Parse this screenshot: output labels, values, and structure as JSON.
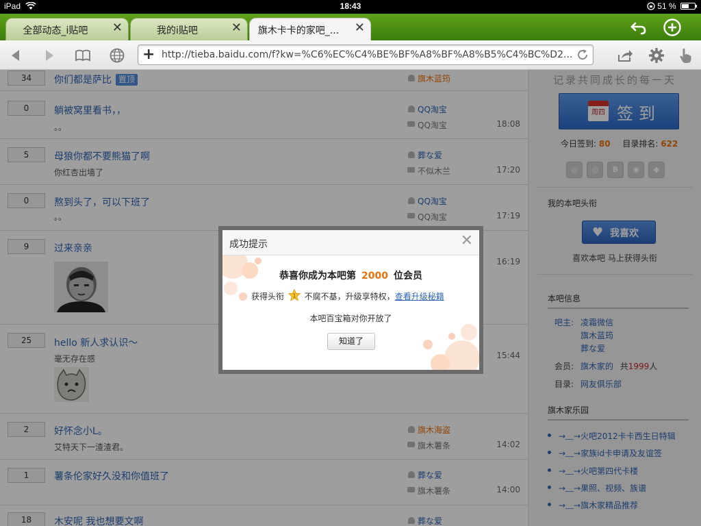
{
  "status_bar": {
    "device": "iPad",
    "time": "18:43",
    "battery": "51 %",
    "battery_level": 0.51
  },
  "tabs": [
    {
      "label": "全部动态_i贴吧",
      "active": false
    },
    {
      "label": "我的i贴吧",
      "active": false
    },
    {
      "label": "旗木卡卡的家吧_...",
      "active": true
    }
  ],
  "toolbar": {
    "url": "http://tieba.baidu.com/f?kw=%C6%EC%C4%BE%BF%A8%BF%A8%B5%C4%BC%D2..."
  },
  "icons": {
    "back": "back-icon",
    "forward": "forward-icon",
    "bookmarks": "bookmarks-icon",
    "globe": "globe-icon",
    "reload": "reload-icon",
    "share": "share-icon",
    "settings": "gear-icon",
    "gesture": "pointer-hand-icon",
    "undo": "undo-icon",
    "new_tab": "plus-circle-icon",
    "close": "close-icon",
    "calendar": "calendar-icon",
    "heart": "heart-icon",
    "star": "star-badge-icon"
  },
  "colors": {
    "tab_bar": "#4b8f14",
    "link": "#2d64b3",
    "accent_orange": "#e8720c",
    "sign_button": "#3c7ad6"
  },
  "threads": [
    {
      "count": "34",
      "title": "你们都是萨比",
      "badge": "置顶",
      "author": "旗木蓝筠",
      "author_highlight": true,
      "excerpt": "",
      "last_reply": "",
      "time": ""
    },
    {
      "count": "0",
      "title": "躺被窝里看书，，",
      "badge": "",
      "author": "QQ淘宝",
      "author_highlight": false,
      "excerpt": "。。",
      "last_reply": "QQ淘宝",
      "time": "18:08"
    },
    {
      "count": "5",
      "title": "母狼你都不要熊猫了啊",
      "badge": "",
      "author": "葬な爱",
      "author_highlight": false,
      "excerpt": "你红杏出墙了",
      "last_reply": "不似木兰",
      "time": "17:20"
    },
    {
      "count": "0",
      "title": "熬到头了，可以下班了",
      "badge": "",
      "author": "QQ淘宝",
      "author_highlight": false,
      "excerpt": "。。",
      "last_reply": "QQ淘宝",
      "time": "17:19"
    },
    {
      "count": "9",
      "title": "过来亲亲",
      "badge": "",
      "author": "",
      "author_highlight": false,
      "excerpt": "",
      "last_reply": "",
      "time": "16:19"
    },
    {
      "count": "25",
      "title": "hello 新人求认识～",
      "badge": "",
      "author": "",
      "author_highlight": false,
      "excerpt": "毫无存在感",
      "last_reply": "",
      "time": "15:44"
    },
    {
      "count": "2",
      "title": "好怀念小L。",
      "badge": "",
      "author": "旗木海盗",
      "author_highlight": true,
      "excerpt": "艾特天下一渣渣君。",
      "last_reply": "旗木薯条",
      "time": "14:02"
    },
    {
      "count": "1",
      "title": "薯条伦家好久没和你值班了",
      "badge": "",
      "author": "葬な爱",
      "author_highlight": false,
      "excerpt": "",
      "last_reply": "旗木薯条",
      "time": "14:00"
    },
    {
      "count": "18",
      "title": "木安呢 我也想要文啊",
      "badge": "",
      "author": "葬な爱",
      "author_highlight": false,
      "excerpt": "",
      "last_reply": "",
      "time": ""
    }
  ],
  "sidebar": {
    "slogan": "记录共同成长的每一天",
    "sign_label": "签到",
    "calendar_day": "周四",
    "today_label": "今日签到:",
    "today_count": "80",
    "rank_label": "目录排名:",
    "rank_value": "622",
    "headline_title": "我的本吧头衔",
    "like_label": "我喜欢",
    "like_hint": "喜欢本吧 马上获得头衔",
    "info_title": "本吧信息",
    "owner_label": "吧主:",
    "owners": [
      "凌霜微信",
      "旗木蓝筠",
      "葬な爱"
    ],
    "member_label": "会员:",
    "member_name": "旗木家的",
    "member_total_prefix": "共",
    "member_count": "1999",
    "member_unit": "人",
    "dir_label": "目录:",
    "dir_value": "网友俱乐部",
    "fan_title": "旗木家乐园",
    "fan_links": [
      "→﹏→火吧2012卡卡西生日特辑",
      "→﹏→家族id卡申请及友谊签",
      "→﹏→火吧第四代卡楼",
      "→﹏→果照、视频、族谱",
      "→﹏→旗木家精品推荐"
    ]
  },
  "dialog": {
    "title": "成功提示",
    "msg_prefix": "恭喜你成为本吧第",
    "member_number": "2000",
    "msg_suffix": "位会员",
    "line2_prefix": "获得头衔",
    "title_badge_level": "1",
    "line2_middle": "不腐不基，升级享特权，",
    "upgrade_link": "查看升级秘籍",
    "line3": "本吧百宝箱对你开放了",
    "ok_label": "知道了"
  }
}
